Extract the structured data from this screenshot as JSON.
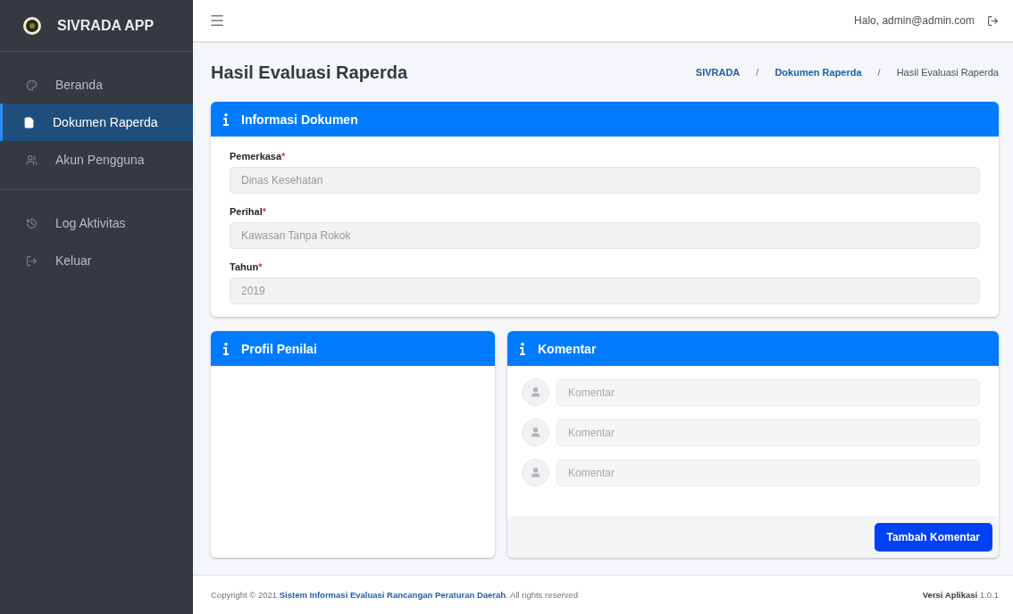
{
  "brand": {
    "name": "SIVRADA APP"
  },
  "sidebar": {
    "groups": [
      [
        {
          "label": "Beranda",
          "selected": false
        },
        {
          "label": "Dokumen Raperda",
          "selected": true
        },
        {
          "label": "Akun Pengguna",
          "selected": false
        }
      ],
      [
        {
          "label": "Log Aktivitas",
          "selected": false
        },
        {
          "label": "Keluar",
          "selected": false
        }
      ]
    ]
  },
  "topbar": {
    "greeting": "Halo, admin@admin.com"
  },
  "page": {
    "title": "Hasil Evaluasi Raperda",
    "breadcrumb": [
      {
        "label": "SIVRADA",
        "link": true
      },
      {
        "label": "Dokumen Raperda",
        "link": true
      },
      {
        "label": "Hasil Evaluasi Raperda",
        "link": false
      }
    ],
    "separator": "/"
  },
  "info_card": {
    "title": "Informasi Dokumen",
    "fields": [
      {
        "label": "Pemerkasa",
        "required_mark": "*",
        "value": "Dinas Kesehatan"
      },
      {
        "label": "Perihal",
        "required_mark": "*",
        "value": "Kawasan Tanpa Rokok"
      },
      {
        "label": "Tahun",
        "required_mark": "*",
        "value": "2019"
      }
    ]
  },
  "profile_card": {
    "title": "Profil Penilai"
  },
  "comment_card": {
    "title": "Komentar",
    "comments": [
      {
        "placeholder": "Komentar"
      },
      {
        "placeholder": "Komentar"
      },
      {
        "placeholder": "Komentar"
      }
    ],
    "button": "Tambah Komentar"
  },
  "footer": {
    "prefix": "Copyright © 2021 ",
    "link": "Sistem Informasi Evaluasi Rancangan Peraturan Daerah",
    "suffix": ". All rights reserved",
    "version": "**Versi Aplikasi** 1.0.1"
  }
}
